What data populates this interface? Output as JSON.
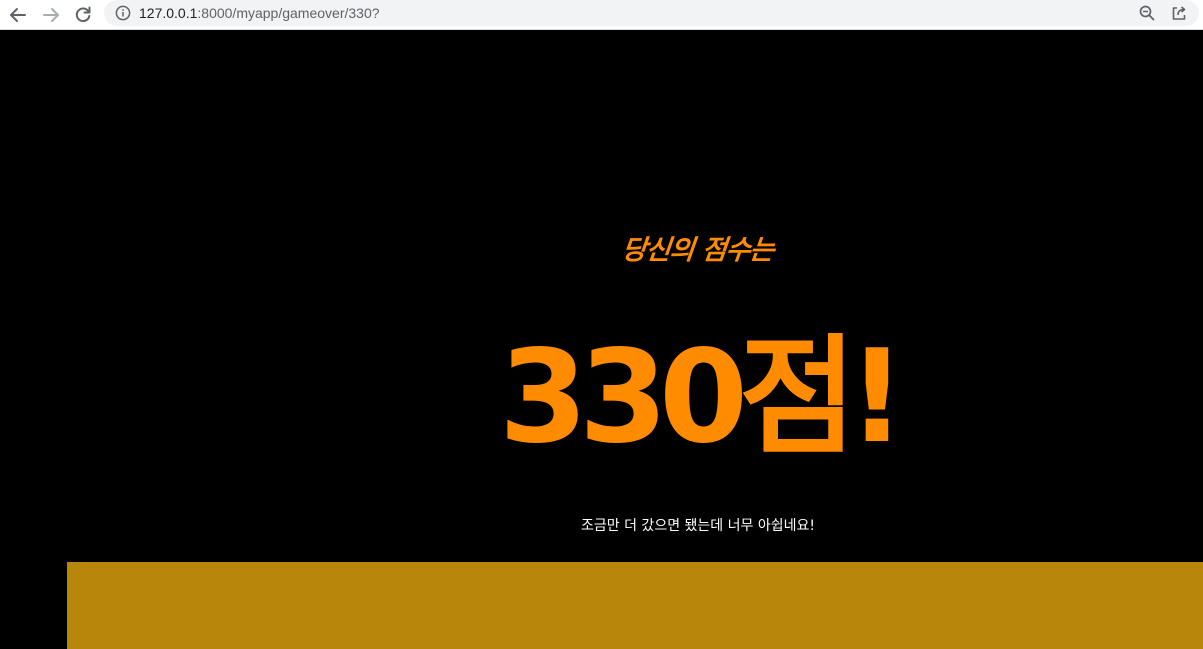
{
  "browser": {
    "url_host": "127.0.0.1",
    "url_path": ":8000/myapp/gameover/330?",
    "icons": [
      "back-arrow-icon",
      "forward-arrow-icon",
      "reload-icon",
      "info-icon",
      "zoom-out-icon",
      "share-icon"
    ]
  },
  "game_over": {
    "subtitle": "당신의 점수는",
    "score_text": "330점!",
    "message": "조금만 더 갔으면 됐는데 너무 아쉽네요!"
  },
  "colors": {
    "background": "#000000",
    "accent": "#ff8c00",
    "message_text": "#ffffff",
    "bottom_panel": "#b8860b"
  }
}
